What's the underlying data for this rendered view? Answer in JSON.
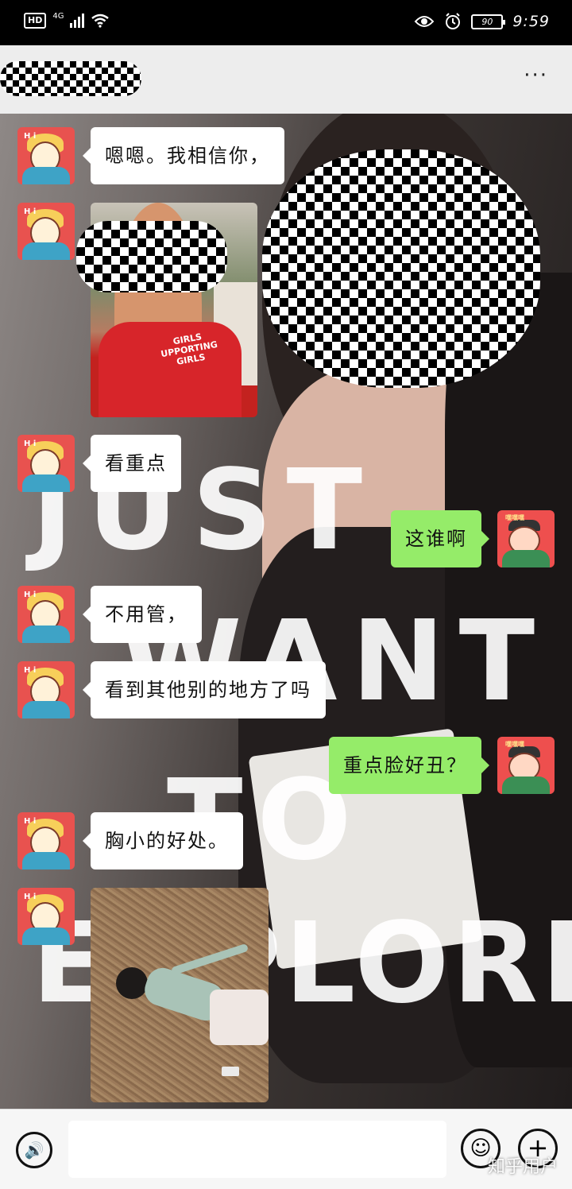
{
  "status_bar": {
    "hd": "HD",
    "network": "4G",
    "battery": "90",
    "time": "9:59"
  },
  "nav": {
    "more_label": "···"
  },
  "background_text": [
    "JUST",
    "WANT",
    "TO",
    "EXPLORE"
  ],
  "messages": [
    {
      "side": "in",
      "text": "嗯嗯。我相信你，"
    },
    {
      "side": "in",
      "type": "image",
      "shirt_text": [
        "GIRLS",
        "UPPORTING",
        "GIRLS"
      ]
    },
    {
      "side": "in",
      "text": "看重点"
    },
    {
      "side": "out",
      "text": "这谁啊"
    },
    {
      "side": "in",
      "text": "不用管，"
    },
    {
      "side": "in",
      "text": "看到其他别的地方了吗"
    },
    {
      "side": "out",
      "text": "重点脸好丑？"
    },
    {
      "side": "in",
      "text": "胸小的好处。"
    },
    {
      "side": "in",
      "type": "image"
    }
  ],
  "avatar_labels": {
    "friend": "H i",
    "me": "嘿嘿嘿"
  },
  "input_bar": {
    "voice_icon": "voice-icon",
    "emoji_icon": "emoji-icon",
    "plus_icon": "plus-icon",
    "voice_glyph": "🔊",
    "emoji_glyph": "☺",
    "plus_glyph": "+"
  },
  "watermark": "知乎用户"
}
